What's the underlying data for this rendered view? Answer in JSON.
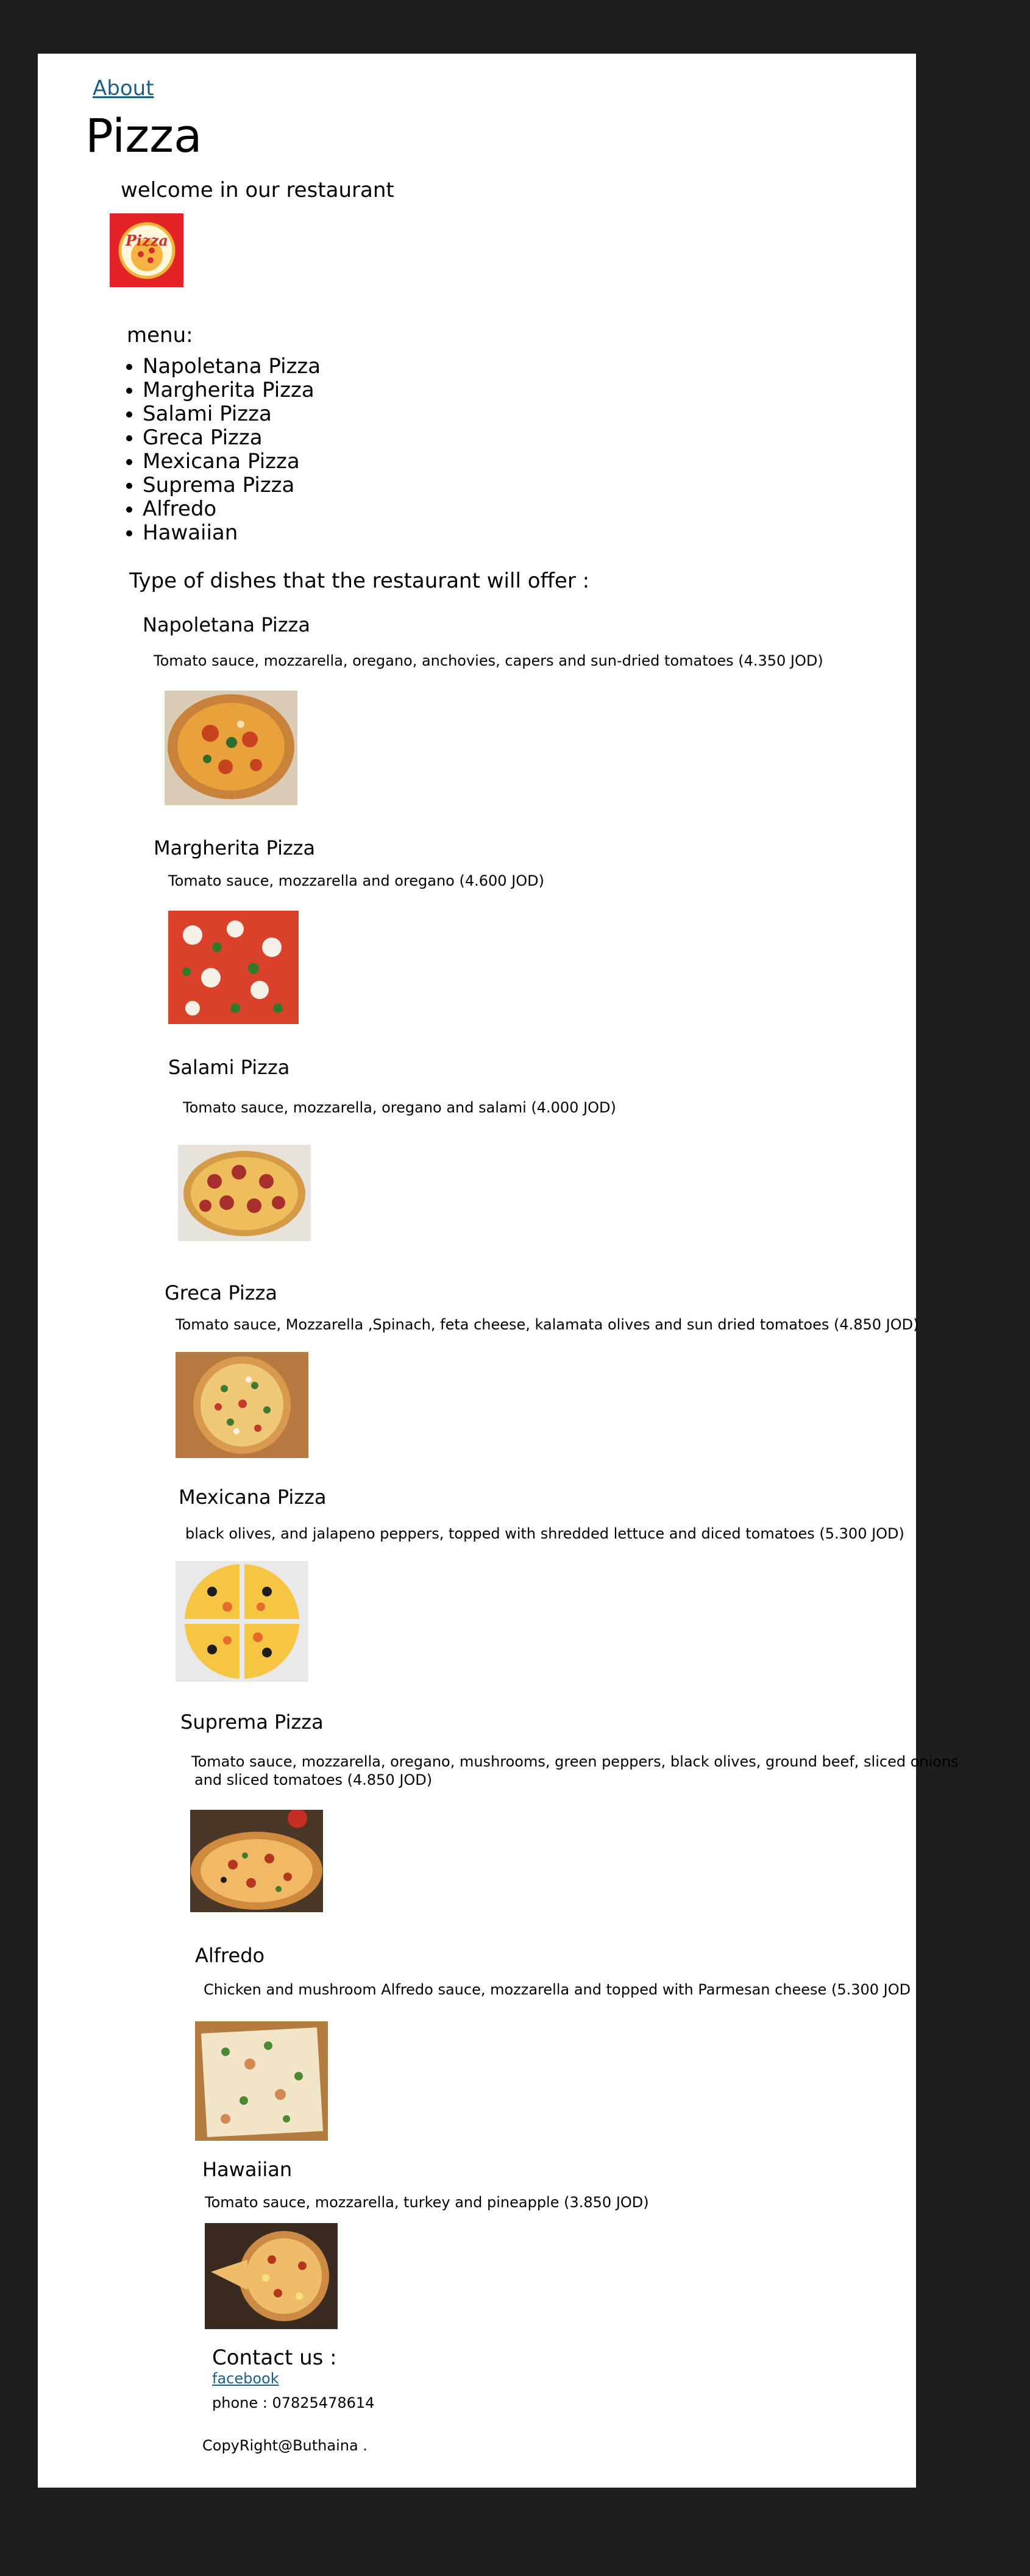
{
  "nav": {
    "about": "About"
  },
  "title": "Pizza",
  "welcome": "welcome in our restaurant",
  "logo_text": "Pizza",
  "menu": {
    "title": "menu:",
    "items": [
      "Napoletana Pizza",
      "Margherita Pizza",
      "Salami Pizza",
      "Greca Pizza",
      "Mexicana Pizza",
      "Suprema Pizza",
      "Alfredo",
      "Hawaiian"
    ]
  },
  "dishes_title": "Type of dishes that the restaurant will offer :",
  "dishes": [
    {
      "name": "Napoletana Pizza",
      "desc": "Tomato sauce, mozzarella, oregano, anchovies, capers and sun-dried tomatoes (4.350 JOD)"
    },
    {
      "name": "Margherita Pizza",
      "desc": "Tomato sauce, mozzarella and oregano (4.600 JOD)"
    },
    {
      "name": "Salami Pizza",
      "desc": "Tomato sauce, mozzarella, oregano and salami (4.000 JOD)"
    },
    {
      "name": "Greca Pizza",
      "desc": "Tomato sauce, Mozzarella ,Spinach, feta cheese, kalamata olives and sun dried tomatoes (4.850 JOD)"
    },
    {
      "name": "Mexicana Pizza",
      "desc": "black olives, and jalapeno peppers, topped with shredded lettuce and diced tomatoes (5.300 JOD)"
    },
    {
      "name": "Suprema Pizza",
      "desc_line1": "Tomato sauce, mozzarella, oregano, mushrooms, green peppers, black olives, ground beef, sliced onions",
      "desc_line2": "and sliced tomatoes (4.850 JOD)"
    },
    {
      "name": "Alfredo",
      "desc": "Chicken and mushroom Alfredo sauce, mozzarella and topped with Parmesan cheese (5.300 JOD"
    },
    {
      "name": "Hawaiian",
      "desc": "Tomato sauce, mozzarella, turkey and pineapple (3.850 JOD)"
    }
  ],
  "contact": {
    "title": "Contact us :",
    "facebook": "facebook",
    "phone": "phone : 07825478614"
  },
  "footer": "CopyRight@Buthaina ."
}
